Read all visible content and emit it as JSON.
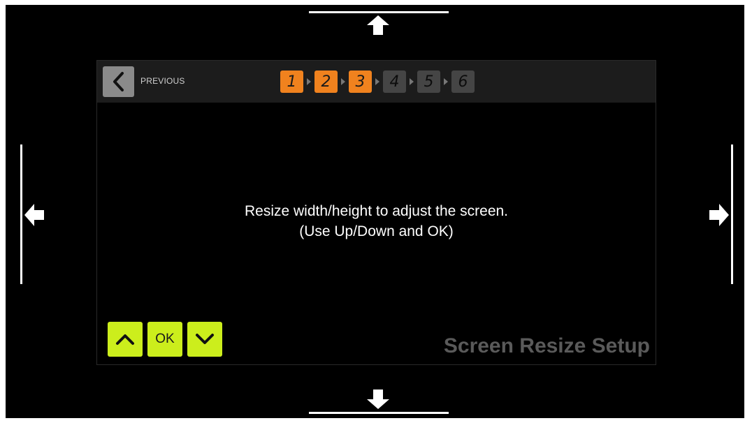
{
  "header": {
    "previous_label": "PREVIOUS",
    "steps": [
      {
        "number": "1",
        "state": "done"
      },
      {
        "number": "2",
        "state": "done"
      },
      {
        "number": "3",
        "state": "done"
      },
      {
        "number": "4",
        "state": "todo"
      },
      {
        "number": "5",
        "state": "todo"
      },
      {
        "number": "6",
        "state": "todo"
      }
    ],
    "current_step": 3,
    "total_steps": 6
  },
  "message": {
    "line1": "Resize width/height to adjust the screen.",
    "line2": "(Use Up/Down and OK)"
  },
  "controls": {
    "up_icon": "chevron-up-icon",
    "ok_label": "OK",
    "down_icon": "chevron-down-icon"
  },
  "setup_title": "Screen Resize Setup",
  "edge_guides": {
    "top": "arrow-up-icon",
    "bottom": "arrow-down-icon",
    "left": "arrow-left-icon",
    "right": "arrow-right-icon"
  },
  "colors": {
    "background": "#000000",
    "step_done": "#f0821e",
    "step_todo": "#454545",
    "control_button": "#ccee1c",
    "title_text": "#5a5a5a",
    "guide_lines": "#ffffff"
  }
}
